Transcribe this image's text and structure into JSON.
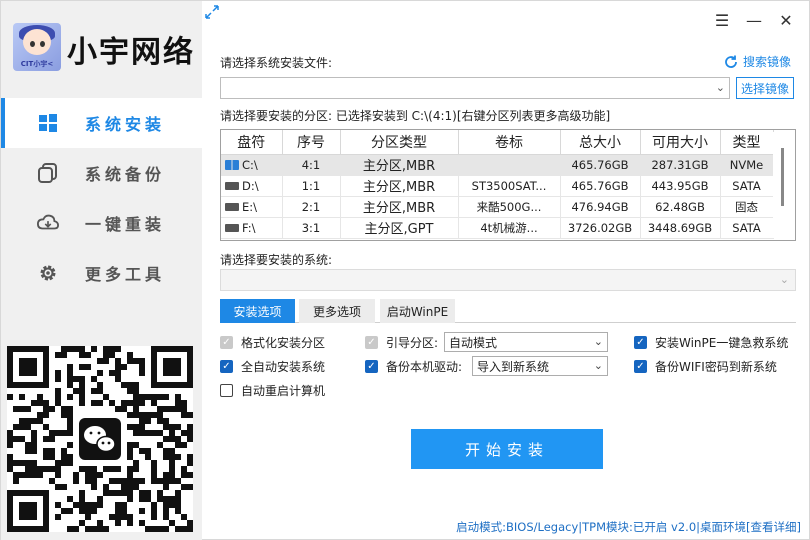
{
  "app": {
    "title": "小宇网络",
    "logo_tag": "CIT小宇<"
  },
  "sidebar": {
    "items": [
      {
        "label": "系统安装",
        "icon": "windows-icon",
        "active": true
      },
      {
        "label": "系统备份",
        "icon": "copy-icon",
        "active": false
      },
      {
        "label": "一键重装",
        "icon": "cloud-icon",
        "active": false
      },
      {
        "label": "更多工具",
        "icon": "gear-icon",
        "active": false
      }
    ]
  },
  "window": {
    "menu_glyph": "☰",
    "minimize_glyph": "—",
    "close_glyph": "✕"
  },
  "file_section": {
    "label": "请选择系统安装文件:",
    "value": "",
    "dropdown_glyph": "⌄",
    "select_button": "选择镜像",
    "search_button": "搜索镜像"
  },
  "partition_section": {
    "label": "请选择要安装的分区: 已选择安装到 C:\\(4:1)[右键分区列表更多高级功能]",
    "columns": [
      "盘符",
      "序号",
      "分区类型",
      "卷标",
      "总大小",
      "可用大小",
      "类型"
    ],
    "rows": [
      {
        "drive": "C:\\",
        "index": "4:1",
        "ptype": "主分区,MBR",
        "volume": "",
        "total": "465.76GB",
        "free": "287.31GB",
        "kind": "NVMe",
        "system": true,
        "selected": true
      },
      {
        "drive": "D:\\",
        "index": "1:1",
        "ptype": "主分区,MBR",
        "volume": "ST3500SAT...",
        "total": "465.76GB",
        "free": "443.95GB",
        "kind": "SATA",
        "system": false,
        "selected": false
      },
      {
        "drive": "E:\\",
        "index": "2:1",
        "ptype": "主分区,MBR",
        "volume": "来酷500G...",
        "total": "476.94GB",
        "free": "62.48GB",
        "kind": "固态",
        "system": false,
        "selected": false
      },
      {
        "drive": "F:\\",
        "index": "3:1",
        "ptype": "主分区,GPT",
        "volume": "4t机械游...",
        "total": "3726.02GB",
        "free": "3448.69GB",
        "kind": "SATA",
        "system": false,
        "selected": false
      }
    ]
  },
  "system_section": {
    "label": "请选择要安装的系统:",
    "value": ""
  },
  "tabs": [
    {
      "label": "安装选项",
      "active": true
    },
    {
      "label": "更多选项",
      "active": false
    },
    {
      "label": "启动WinPE",
      "active": false
    }
  ],
  "options": {
    "format_partition": {
      "label": "格式化安装分区",
      "state": "checked-disabled"
    },
    "boot_partition": {
      "label": "引导分区:",
      "state": "checked-disabled",
      "select_value": "自动模式"
    },
    "install_winpe": {
      "label": "安装WinPE一键急救系统",
      "state": "checked"
    },
    "auto_install": {
      "label": "全自动安装系统",
      "state": "checked"
    },
    "backup_drivers": {
      "label": "备份本机驱动:",
      "state": "checked",
      "select_value": "导入到新系统"
    },
    "backup_wifi": {
      "label": "备份WIFI密码到新系统",
      "state": "checked"
    },
    "auto_reboot": {
      "label": "自动重启计算机",
      "state": "unchecked"
    }
  },
  "start_button": "开始安装",
  "status_bar": {
    "boot_mode": "启动模式:BIOS/Legacy",
    "tpm": "|TPM模块:已开启",
    "version": " v2.0|桌面环境",
    "details": "[查看详细]"
  },
  "colors": {
    "accent": "#1e88e5",
    "start_button": "#2196f3"
  }
}
